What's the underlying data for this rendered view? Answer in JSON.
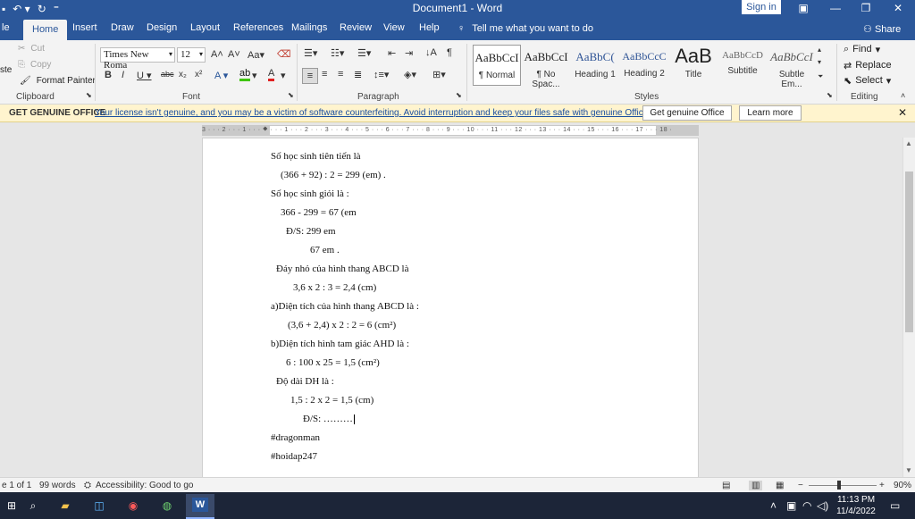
{
  "app": {
    "doc_title": "Document1 - Word",
    "sign_in": "Sign in"
  },
  "tabs": {
    "file": "le",
    "home": "Home",
    "insert": "Insert",
    "draw": "Draw",
    "design": "Design",
    "layout": "Layout",
    "references": "References",
    "mailings": "Mailings",
    "review": "Review",
    "view": "View",
    "help": "Help",
    "tell_me": "Tell me what you want to do",
    "share": "Share"
  },
  "ribbon": {
    "clipboard": {
      "label": "Clipboard",
      "cut": "Cut",
      "copy": "Copy",
      "paste": "ste",
      "format_painter": "Format Painter"
    },
    "font": {
      "label": "Font",
      "family": "Times New Roma",
      "size": "12"
    },
    "paragraph": {
      "label": "Paragraph"
    },
    "styles": {
      "label": "Styles",
      "items": [
        {
          "sample": "AaBbCcI",
          "name": "¶ Normal"
        },
        {
          "sample": "AaBbCcI",
          "name": "¶ No Spac..."
        },
        {
          "sample": "AaBbC(",
          "name": "Heading 1"
        },
        {
          "sample": "AaBbCcC",
          "name": "Heading 2"
        },
        {
          "sample": "AaB",
          "name": "Title"
        },
        {
          "sample": "AaBbCcD",
          "name": "Subtitle"
        },
        {
          "sample": "AaBbCcI",
          "name": "Subtle Em..."
        }
      ]
    },
    "editing": {
      "label": "Editing",
      "find": "Find",
      "replace": "Replace",
      "select": "Select"
    }
  },
  "notification": {
    "label": "GET GENUINE OFFICE",
    "message": "Your license isn't genuine, and you may be a victim of software counterfeiting. Avoid interruption and keep your files safe with genuine Office today.",
    "primary_button": "Get genuine Office",
    "secondary_button": "Learn more"
  },
  "ruler": {
    "ticks": "3 · · · 2 · · · 1 · · · ⯁ · · · 1 · · · 2 · · · 3 · · · 4 · · · 5 · · · 6 · · · 7 · · · 8 · · · 9 · · · 10 · · · 11 · · · 12 · · · 13 · · · 14 · · · 15 · · · 16 · · · 17 · · · 18 ·"
  },
  "document": {
    "lines": [
      "Số học sinh tiên tiến là",
      "(366 + 92) : 2 = 299 (em) .",
      "Số học sinh giỏi là :",
      "366 - 299 = 67 (em",
      "Đ/S: 299 em",
      "67 em .",
      "Đáy nhỏ của hình thang ABCD là",
      "3,6 x 2 : 3 = 2,4 (cm)",
      "a)Diện tích của hình thang ABCD là :",
      "(3,6 + 2,4) x 2 : 2 = 6 (cm²)",
      "b)Diện tích hình tam giác AHD là :",
      "6 : 100 x 25 = 1,5 (cm²)",
      "Độ dài DH là :",
      "1,5 : 2 x 2 = 1,5 (cm)",
      "Đ/S: ………",
      "#dragonman",
      "#hoidap247"
    ]
  },
  "status": {
    "page": "e 1 of 1",
    "words": "99 words",
    "accessibility": "Accessibility: Good to go",
    "zoom": "90%"
  },
  "taskbar": {
    "time": "11:13 PM",
    "date": "11/4/2022"
  },
  "icons": {
    "undo": "undo-icon",
    "redo": "redo-icon",
    "share": "person-icon",
    "lightbulb": "lightbulb-icon"
  }
}
